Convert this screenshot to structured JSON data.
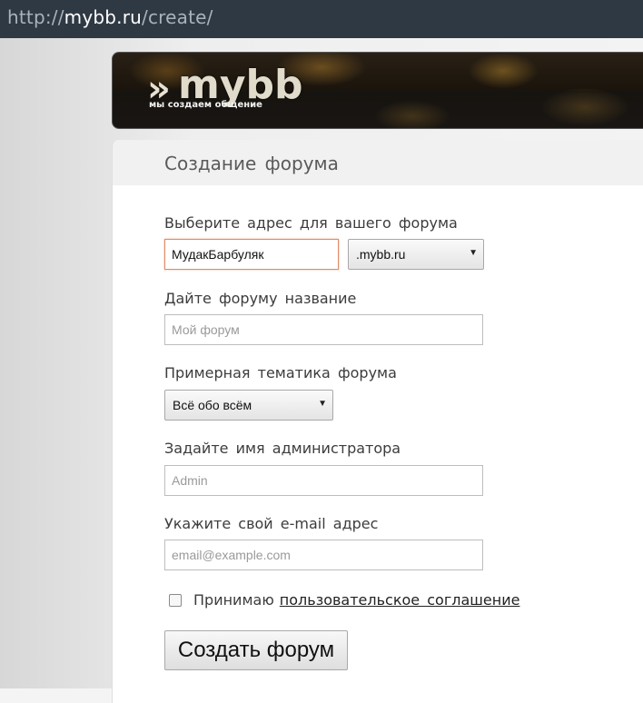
{
  "browser": {
    "url_protocol": "http://",
    "url_host": "mybb.ru",
    "url_path": "/create/"
  },
  "brand": {
    "logo_mark": "»",
    "logo_text": "mybb",
    "tagline": "мы создаем общение"
  },
  "form": {
    "title": "Создание форума",
    "address_label": "Выберите адрес для вашего форума",
    "address_value": "МудакБарбуляк",
    "domain_selected": ".mybb.ru",
    "name_label": "Дайте форуму название",
    "name_placeholder": "Мой форум",
    "topic_label": "Примерная тематика форума",
    "topic_selected": "Всё обо всём",
    "admin_label": "Задайте имя администратора",
    "admin_placeholder": "Admin",
    "email_label": "Укажите свой e-mail адрес",
    "email_placeholder": "email@example.com",
    "accept_text": "Принимаю",
    "agreement_link": "пользовательское соглашение",
    "submit_label": "Создать форум"
  }
}
